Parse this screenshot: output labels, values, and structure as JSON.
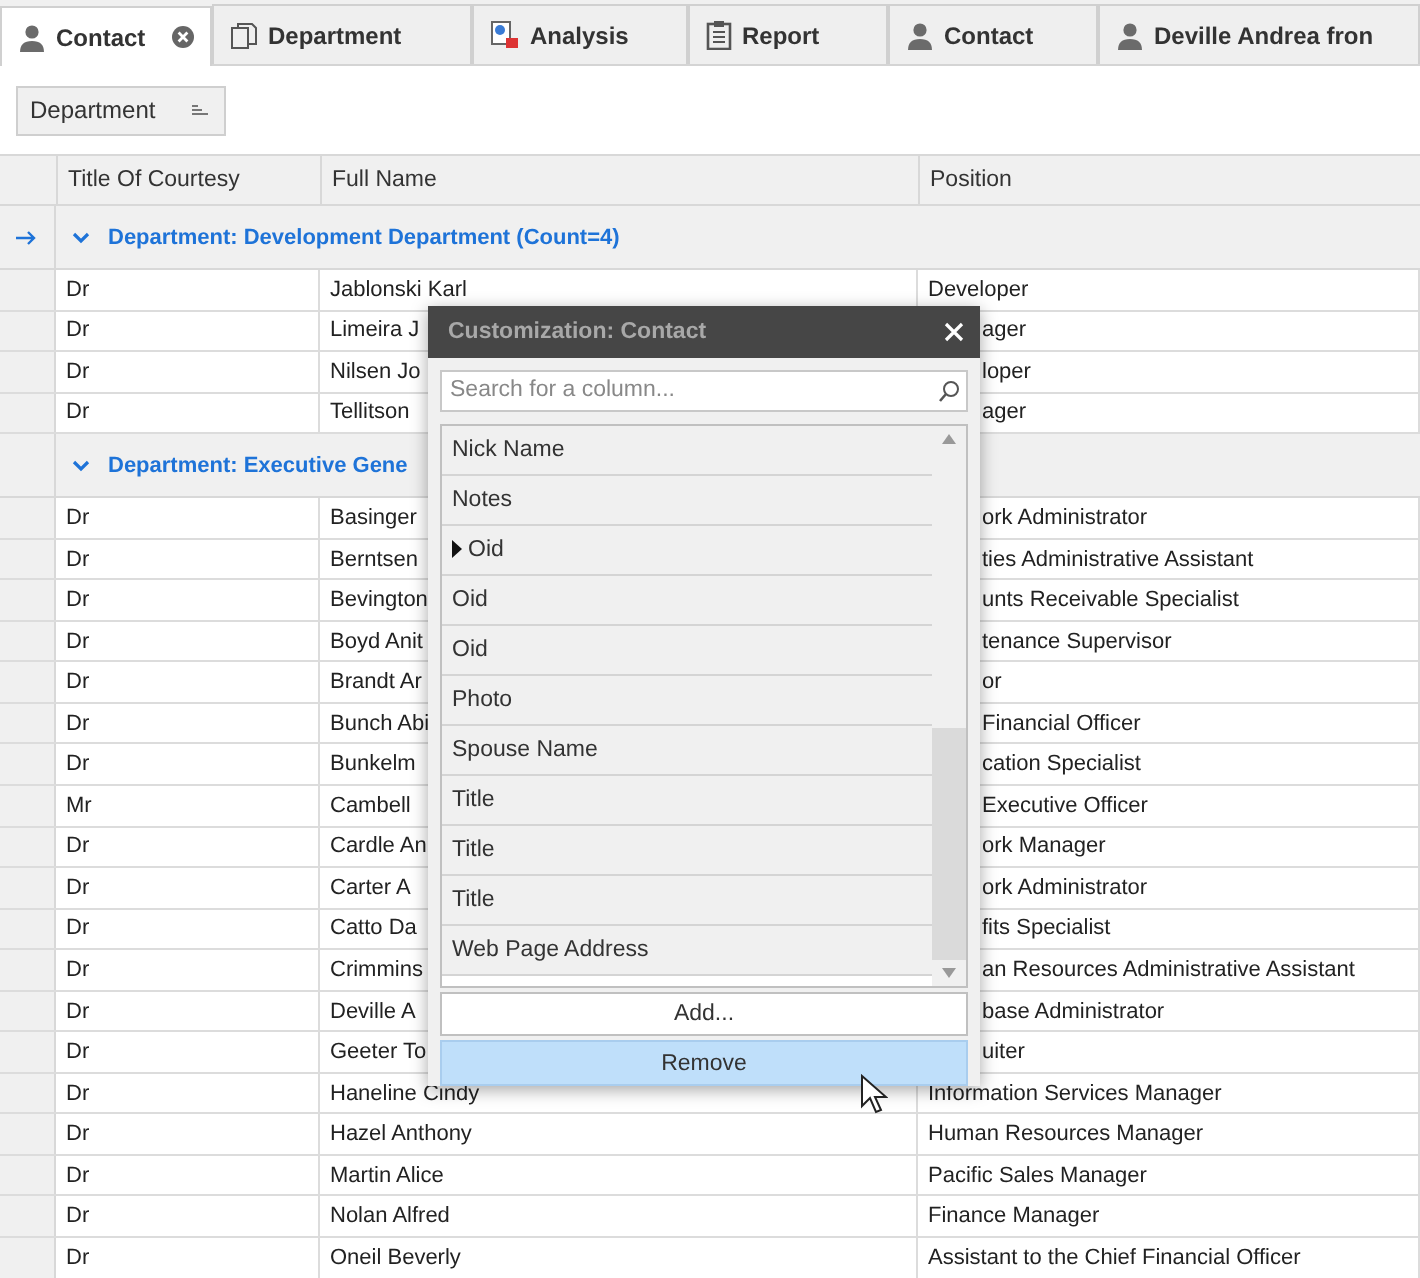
{
  "tabs": [
    {
      "label": "Contact",
      "kind": "person",
      "selected": true
    },
    {
      "label": "Department",
      "kind": "copy",
      "selected": false
    },
    {
      "label": "Analysis",
      "kind": "chart",
      "selected": false
    },
    {
      "label": "Report",
      "kind": "clipboard",
      "selected": false
    },
    {
      "label": "Contact",
      "kind": "person",
      "selected": false
    },
    {
      "label": "Deville Andrea fron",
      "kind": "person",
      "selected": false
    }
  ],
  "group_panel": {
    "group_button": "Department"
  },
  "grid": {
    "columns": [
      "Title Of Courtesy",
      "Full Name",
      "Position"
    ],
    "groups": [
      {
        "label": "Department: Development Department (Count=4)",
        "expanded": true,
        "focused": true,
        "rows": [
          {
            "title": "Dr",
            "name": "Jablonski Karl",
            "position": "Developer",
            "under_dialog": false
          },
          {
            "title": "Dr",
            "name": "Limeira J",
            "position": "ager",
            "under_dialog": true
          },
          {
            "title": "Dr",
            "name": "Nilsen Jo",
            "position": "loper",
            "under_dialog": true
          },
          {
            "title": "Dr",
            "name": "Tellitson",
            "position": "ager",
            "under_dialog": true
          }
        ]
      },
      {
        "label": "Department: Executive Gene",
        "expanded": true,
        "focused": false,
        "rows": [
          {
            "title": "Dr",
            "name": "Basinger",
            "position": "ork Administrator",
            "under_dialog": true
          },
          {
            "title": "Dr",
            "name": "Berntsen",
            "position": "ties Administrative Assistant",
            "under_dialog": true
          },
          {
            "title": "Dr",
            "name": "Bevington",
            "position": "unts Receivable Specialist",
            "under_dialog": true
          },
          {
            "title": "Dr",
            "name": "Boyd Anit",
            "position": "tenance Supervisor",
            "under_dialog": true
          },
          {
            "title": "Dr",
            "name": "Brandt Ar",
            "position": "or",
            "under_dialog": true
          },
          {
            "title": "Dr",
            "name": "Bunch Abi",
            "position": "Financial Officer",
            "under_dialog": true
          },
          {
            "title": "Dr",
            "name": "Bunkelm",
            "position": "cation Specialist",
            "under_dialog": true
          },
          {
            "title": "Mr",
            "name": "Cambell",
            "position": "Executive Officer",
            "under_dialog": true
          },
          {
            "title": "Dr",
            "name": "Cardle An",
            "position": "ork Manager",
            "under_dialog": true
          },
          {
            "title": "Dr",
            "name": "Carter A",
            "position": "ork Administrator",
            "under_dialog": true
          },
          {
            "title": "Dr",
            "name": "Catto Da",
            "position": "fits Specialist",
            "under_dialog": true
          },
          {
            "title": "Dr",
            "name": "Crimmins",
            "position": "an Resources Administrative Assistant",
            "under_dialog": true
          },
          {
            "title": "Dr",
            "name": "Deville A",
            "position": "base Administrator",
            "under_dialog": true
          },
          {
            "title": "Dr",
            "name": "Geeter To",
            "position": "uiter",
            "under_dialog": true
          },
          {
            "title": "Dr",
            "name": "Haneline Cindy",
            "position": "Information Services Manager",
            "under_dialog": false
          },
          {
            "title": "Dr",
            "name": "Hazel Anthony",
            "position": "Human Resources Manager",
            "under_dialog": false
          },
          {
            "title": "Dr",
            "name": "Martin Alice",
            "position": "Pacific Sales Manager",
            "under_dialog": false
          },
          {
            "title": "Dr",
            "name": "Nolan Alfred",
            "position": "Finance Manager",
            "under_dialog": false
          },
          {
            "title": "Dr",
            "name": "Oneil Beverly",
            "position": "Assistant to the Chief Financial Officer",
            "under_dialog": false
          }
        ]
      }
    ]
  },
  "dialog": {
    "title": "Customization: Contact",
    "search": {
      "placeholder": "Search for a column..."
    },
    "items": [
      {
        "label": "Nick Name",
        "current": false
      },
      {
        "label": "Notes",
        "current": false
      },
      {
        "label": "Oid",
        "current": true
      },
      {
        "label": "Oid",
        "current": false
      },
      {
        "label": "Oid",
        "current": false
      },
      {
        "label": "Photo",
        "current": false
      },
      {
        "label": "Spouse Name",
        "current": false
      },
      {
        "label": "Title",
        "current": false
      },
      {
        "label": "Title",
        "current": false
      },
      {
        "label": "Title",
        "current": false
      },
      {
        "label": "Web Page Address",
        "current": false
      }
    ],
    "buttons": [
      {
        "label": "Add...",
        "hovered": false
      },
      {
        "label": "Remove",
        "hovered": true
      }
    ]
  }
}
